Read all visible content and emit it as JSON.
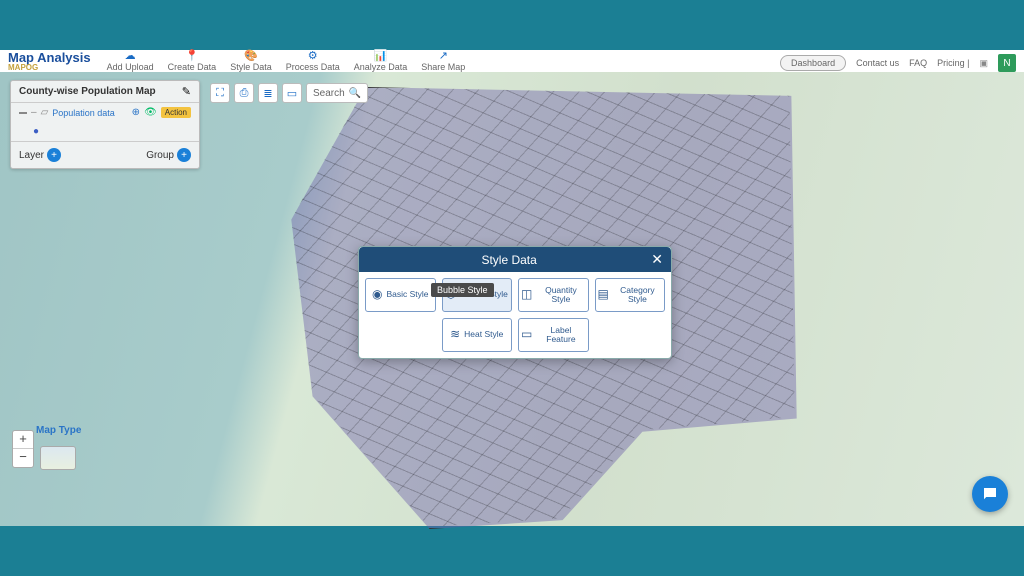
{
  "brand": {
    "title": "Map Analysis",
    "sub": "MAPOG"
  },
  "menu": [
    {
      "label": "Add Upload",
      "icon": "☁"
    },
    {
      "label": "Create Data",
      "icon": "📍"
    },
    {
      "label": "Style Data",
      "icon": "🎨"
    },
    {
      "label": "Process Data",
      "icon": "⚙"
    },
    {
      "label": "Analyze Data",
      "icon": "📊"
    },
    {
      "label": "Share Map",
      "icon": "↗"
    }
  ],
  "topRight": {
    "dashboard": "Dashboard",
    "contact": "Contact us",
    "faq": "FAQ",
    "pricing": "Pricing |",
    "avatarLetter": "N"
  },
  "layerPanel": {
    "title": "County-wise Population Map",
    "dataLink": "Population data",
    "actionChip": "Action",
    "layerBtn": "Layer",
    "groupBtn": "Group"
  },
  "search": {
    "placeholder": "Search"
  },
  "mapType": {
    "label": "Map Type"
  },
  "dialog": {
    "title": "Style Data",
    "tooltip": "Bubble Style",
    "options": [
      {
        "label": "Basic Style",
        "icon": "◉"
      },
      {
        "label": "Bubble Style",
        "icon": "⬡",
        "selected": true
      },
      {
        "label": "Quantity Style",
        "icon": "◫"
      },
      {
        "label": "Category Style",
        "icon": "▤"
      },
      {
        "label": "Heat Style",
        "icon": "≋"
      },
      {
        "label": "Label Feature",
        "icon": "▭"
      }
    ]
  }
}
